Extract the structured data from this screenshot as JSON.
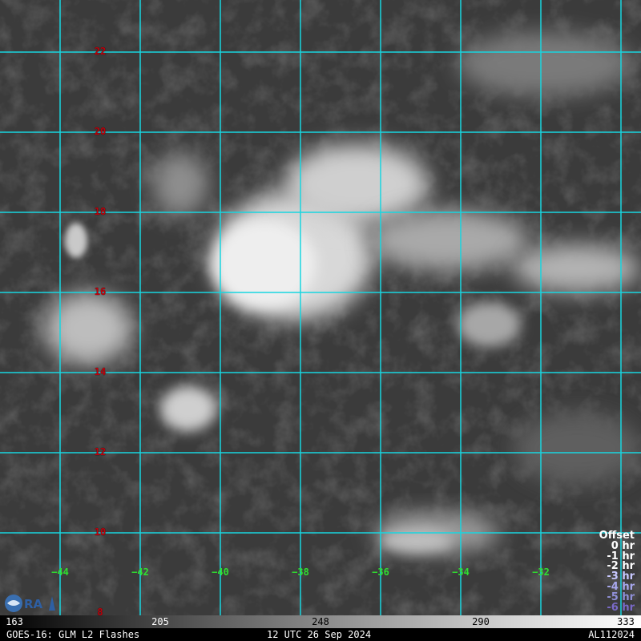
{
  "map": {
    "latitude_labels": [
      "22",
      "20",
      "18",
      "16",
      "14",
      "12",
      "10",
      "8"
    ],
    "longitude_labels": [
      "−44",
      "−42",
      "−40",
      "−38",
      "−36",
      "−34",
      "−32"
    ],
    "grid_color": "#18d6e0",
    "lat_label_color": "#c0000a",
    "lon_label_color": "#2fe02f"
  },
  "offset_legend": {
    "title": "Offset",
    "items": [
      {
        "label": "0 hr",
        "color": "#ffffff"
      },
      {
        "label": "-1 hr",
        "color": "#ffffff"
      },
      {
        "label": "-2 hr",
        "color": "#ffffff"
      },
      {
        "label": "-3 hr",
        "color": "#c8c8ff"
      },
      {
        "label": "-4 hr",
        "color": "#a8a8ee"
      },
      {
        "label": "-5 hr",
        "color": "#9090d8"
      },
      {
        "label": "-6 hr",
        "color": "#7a6ac8"
      }
    ]
  },
  "colorbar": {
    "ticks": [
      "163",
      "205",
      "248",
      "290",
      "333"
    ]
  },
  "footer": {
    "left": "GOES-16: GLM L2 Flashes",
    "center": "12 UTC 26 Sep 2024",
    "right": "AL112024"
  },
  "logo": {
    "icon": "cira-logo-icon",
    "text": "CIRA"
  }
}
